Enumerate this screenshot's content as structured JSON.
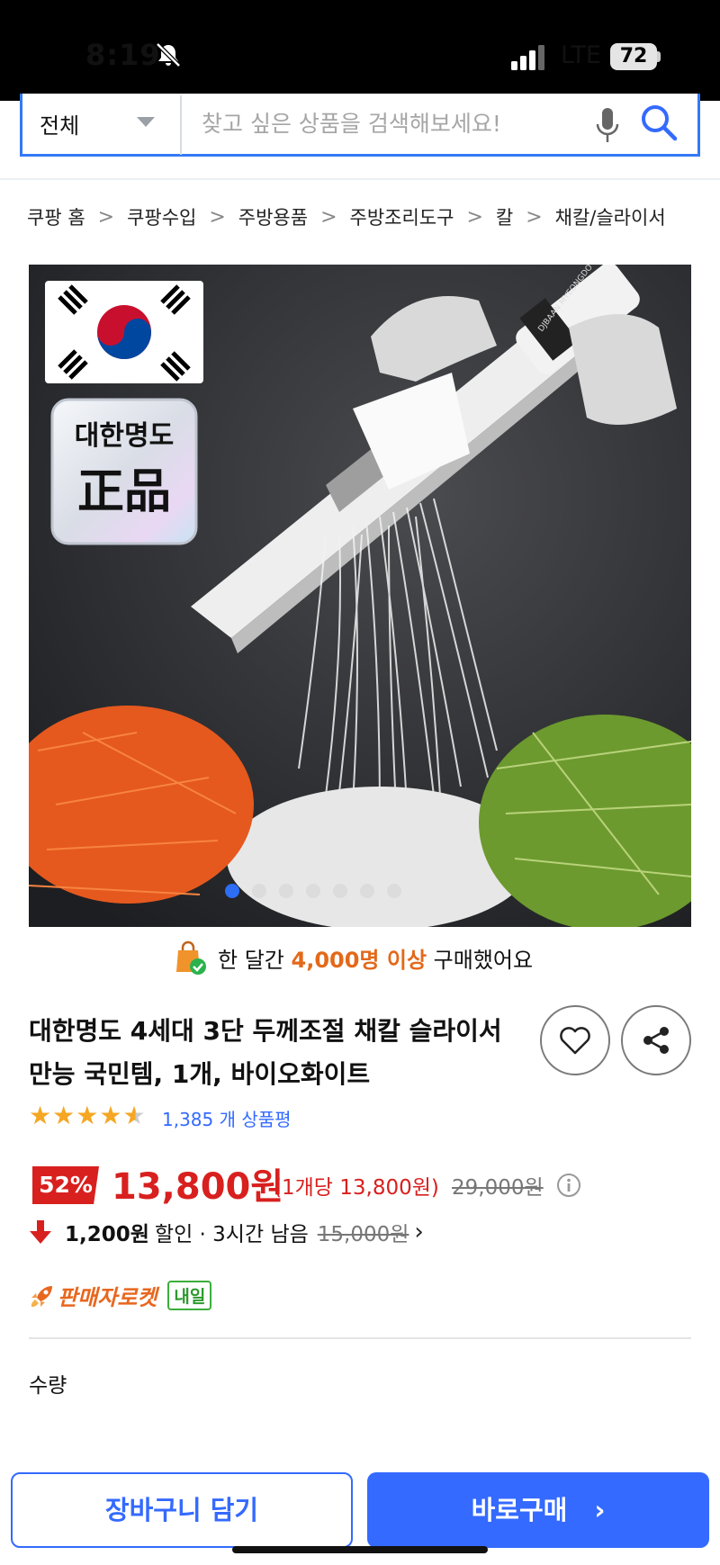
{
  "status_bar": {
    "time": "8:19",
    "network": "LTE",
    "battery": "72"
  },
  "search": {
    "category": "전체",
    "placeholder": "찾고 싶은 상품을 검색해보세요!"
  },
  "breadcrumb": [
    "쿠팡 홈",
    "쿠팡수입",
    "주방용품",
    "주방조리도구",
    "칼",
    "채칼/슬라이서"
  ],
  "product_image": {
    "badge_top": "대한명도",
    "badge_bottom": "正品",
    "brand_text": "DJBAAN MYEONGDO",
    "slide_count": 7,
    "active_slide": 1
  },
  "sold": {
    "prefix": "한 달간",
    "highlight": "4,000명 이상",
    "suffix": "구매했어요"
  },
  "product": {
    "title": "대한명도 4세대 3단 두께조절 채칼 슬라이서 만능 국민템, 1개, 바이오화이트",
    "rating": 4.5,
    "review_count": "1,385 개 상품평"
  },
  "price": {
    "discount": "52%",
    "sale_price": "13,800원",
    "unit_price": "(1개당 13,800원)",
    "original_price": "29,000원"
  },
  "coupon": {
    "amount": "1,200원",
    "text": "할인 · 3시간 남음",
    "strike_price": "15,000원"
  },
  "delivery": {
    "label": "판매자로켓",
    "badge": "내일"
  },
  "quantity_label": "수량",
  "actions": {
    "cart": "장바구니 담기",
    "buy": "바로구매"
  },
  "colors": {
    "accent": "#346aff",
    "price_red": "#d8201e",
    "rocket_orange": "#e8671e",
    "badge_green": "#2b9a2b"
  }
}
